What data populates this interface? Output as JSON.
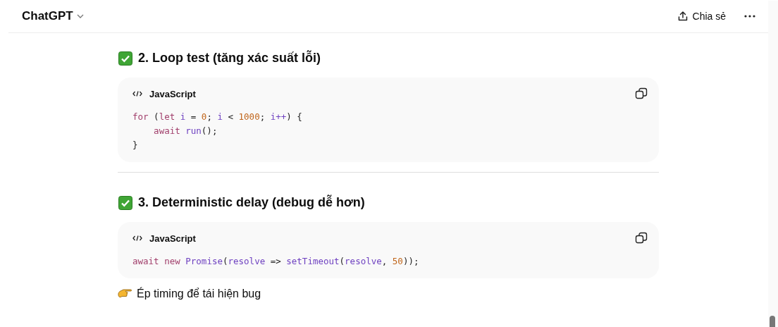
{
  "header": {
    "title": "ChatGPT",
    "share_label": "Chia sẻ"
  },
  "blocks": [
    {
      "kind": "heading",
      "text": "2. Loop test (tăng xác suất lỗi)"
    },
    {
      "kind": "code",
      "language": "JavaScript",
      "lines": [
        [
          {
            "t": "for",
            "kind": "keyword"
          },
          {
            "t": " (",
            "kind": "plain"
          },
          {
            "t": "let",
            "kind": "keyword"
          },
          {
            "t": " i",
            "kind": "name"
          },
          {
            "t": " = ",
            "kind": "plain"
          },
          {
            "t": "0",
            "kind": "number"
          },
          {
            "t": "; ",
            "kind": "plain"
          },
          {
            "t": "i",
            "kind": "name"
          },
          {
            "t": " < ",
            "kind": "plain"
          },
          {
            "t": "1000",
            "kind": "number"
          },
          {
            "t": "; ",
            "kind": "plain"
          },
          {
            "t": "i++",
            "kind": "name"
          },
          {
            "t": ") {",
            "kind": "plain"
          }
        ],
        [
          {
            "t": "    await",
            "kind": "keyword"
          },
          {
            "t": " run",
            "kind": "name"
          },
          {
            "t": "();",
            "kind": "plain"
          }
        ],
        [
          {
            "t": "}",
            "kind": "plain"
          }
        ]
      ]
    },
    {
      "kind": "divider"
    },
    {
      "kind": "heading",
      "text": "3. Deterministic delay (debug dễ hơn)"
    },
    {
      "kind": "code",
      "language": "JavaScript",
      "lines": [
        [
          {
            "t": "await",
            "kind": "keyword"
          },
          {
            "t": " new",
            "kind": "keyword"
          },
          {
            "t": " Promise",
            "kind": "name"
          },
          {
            "t": "(",
            "kind": "plain"
          },
          {
            "t": "resolve",
            "kind": "name"
          },
          {
            "t": " => ",
            "kind": "plain"
          },
          {
            "t": "setTimeout",
            "kind": "name"
          },
          {
            "t": "(",
            "kind": "plain"
          },
          {
            "t": "resolve",
            "kind": "name"
          },
          {
            "t": ", ",
            "kind": "plain"
          },
          {
            "t": "50",
            "kind": "number"
          },
          {
            "t": "));",
            "kind": "plain"
          }
        ]
      ]
    },
    {
      "kind": "note",
      "text": "Ép timing để tái hiện bug"
    }
  ]
}
